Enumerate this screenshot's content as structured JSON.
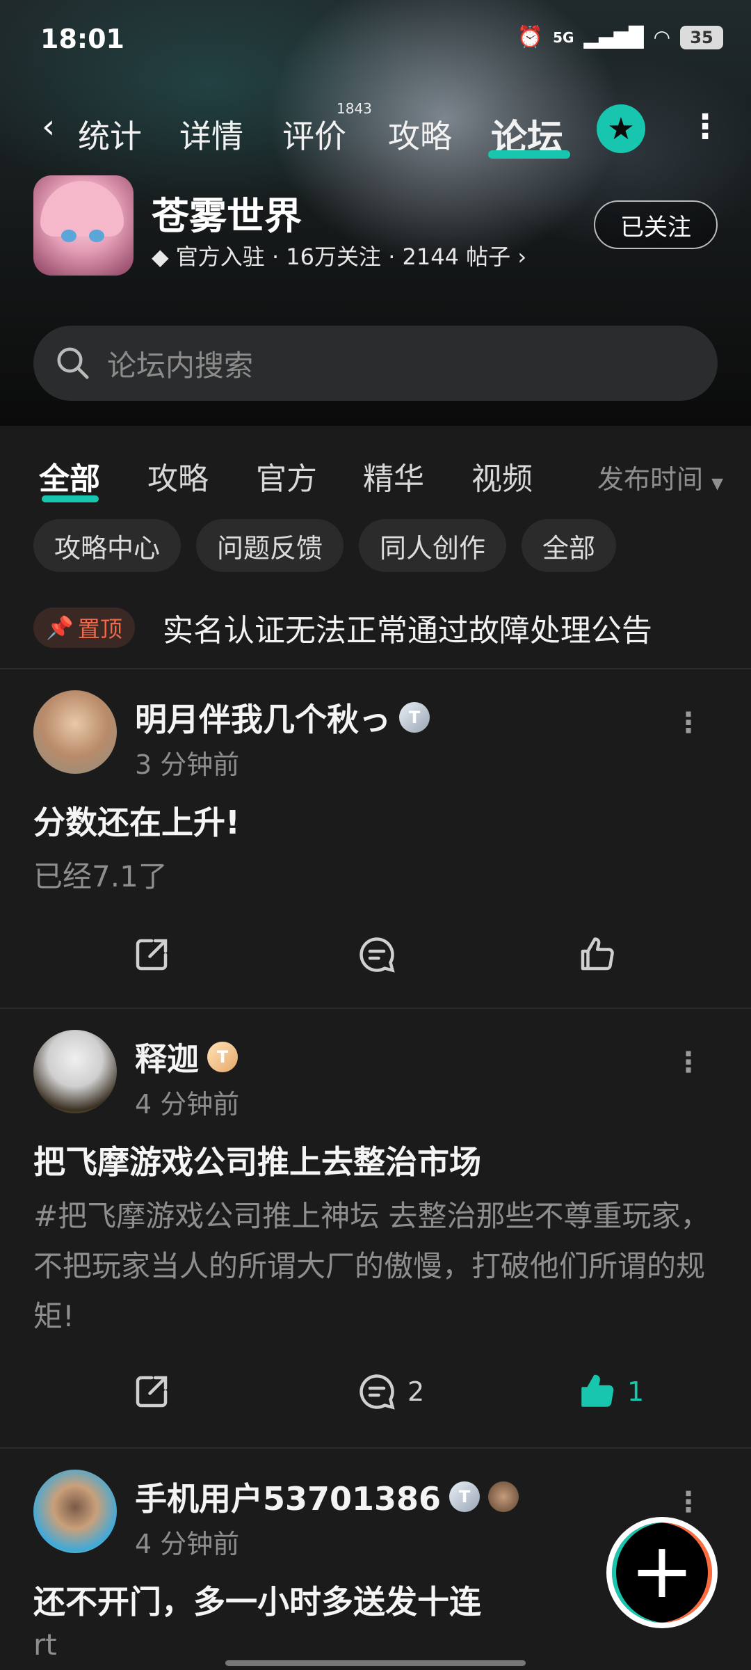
{
  "status_bar": {
    "time": "18:01",
    "network": "5G",
    "battery": "35"
  },
  "nav": {
    "tabs": [
      "统计",
      "详情",
      "评价",
      "攻略",
      "论坛"
    ],
    "active_tab": "论坛",
    "review_count": "1843"
  },
  "game": {
    "name": "苍雾世界",
    "meta": "官方入驻 · 16万关注 · 2144 帖子",
    "follow_label": "已关注"
  },
  "search": {
    "placeholder": "论坛内搜索"
  },
  "forum_tabs": [
    "全部",
    "攻略",
    "官方",
    "精华",
    "视频"
  ],
  "sort_label": "发布时间",
  "chips": [
    "攻略中心",
    "问题反馈",
    "同人创作",
    "全部"
  ],
  "pinned": {
    "tag": "置顶",
    "title": "实名认证无法正常通过故障处理公告"
  },
  "posts": [
    {
      "user": "明月伴我几个秋っ",
      "time": "3 分钟前",
      "title": "分数还在上升!",
      "body": "已经7.1了",
      "comments": "",
      "likes": ""
    },
    {
      "user": "释迦",
      "time": "4 分钟前",
      "title": "把飞摩游戏公司推上去整治市场",
      "body": "#把飞摩游戏公司推上神坛 去整治那些不尊重玩家，不把玩家当人的所谓大厂的傲慢，打破他们所谓的规矩!",
      "comments": "2",
      "likes": "1"
    },
    {
      "user": "手机用户53701386",
      "time": "4 分钟前",
      "title": "还不开门，多一小时多送发十连",
      "body": "rt"
    }
  ],
  "colors": {
    "accent": "#18c6b0",
    "pin": "#f26a4c",
    "background": "#1b1b1b"
  }
}
